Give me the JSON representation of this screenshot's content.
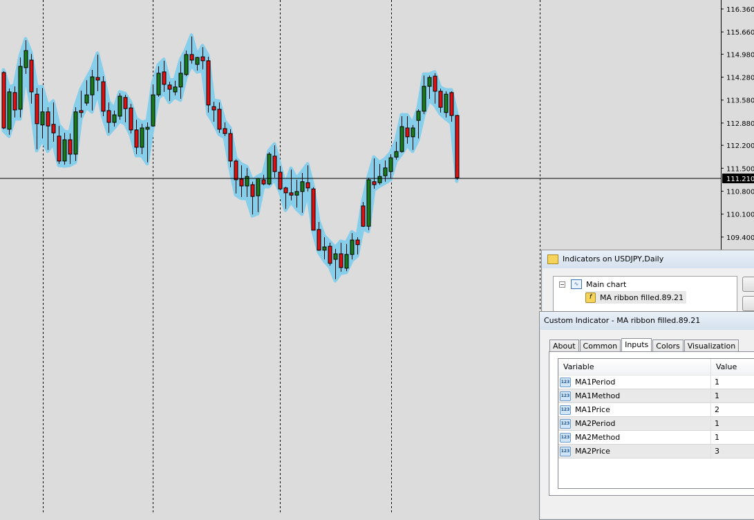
{
  "chart": {
    "symbol": "USDJPY",
    "timeframe": "Daily",
    "current_price_label": "111.210",
    "colors": {
      "background": "#dcdcdc",
      "bull": "#1a7a1a",
      "bear": "#e01010",
      "ribbon": "#87ceeb",
      "price_line": "#000000"
    },
    "chart_data": {
      "type": "candlestick",
      "y_ticks": [
        "116.360",
        "115.660",
        "114.980",
        "114.280",
        "113.580",
        "112.880",
        "112.200",
        "111.500",
        "110.800",
        "110.100",
        "109.400"
      ],
      "ylim": [
        108.0,
        116.6
      ],
      "grid": "vertical dashed",
      "ohlc": [
        [
          114.42,
          114.46,
          112.69,
          112.73
        ],
        [
          112.69,
          113.93,
          112.52,
          113.83
        ],
        [
          113.81,
          114.0,
          113.05,
          113.28
        ],
        [
          113.3,
          114.88,
          113.05,
          114.61
        ],
        [
          114.57,
          115.41,
          114.38,
          115.09
        ],
        [
          114.8,
          114.99,
          113.47,
          113.83
        ],
        [
          113.76,
          113.95,
          112.08,
          112.86
        ],
        [
          112.82,
          113.95,
          112.41,
          113.22
        ],
        [
          113.22,
          113.36,
          112.06,
          112.79
        ],
        [
          112.84,
          113.51,
          112.31,
          112.58
        ],
        [
          112.48,
          112.79,
          111.63,
          111.72
        ],
        [
          111.72,
          112.58,
          111.61,
          112.37
        ],
        [
          112.37,
          112.56,
          111.63,
          111.93
        ],
        [
          111.93,
          113.36,
          111.72,
          113.22
        ],
        [
          113.26,
          113.87,
          113.05,
          113.2
        ],
        [
          113.49,
          114.19,
          113.41,
          113.74
        ],
        [
          113.74,
          114.5,
          113.26,
          114.29
        ],
        [
          114.27,
          114.97,
          113.85,
          114.19
        ],
        [
          114.14,
          114.31,
          113.09,
          113.24
        ],
        [
          113.26,
          113.51,
          112.58,
          112.9
        ],
        [
          112.9,
          113.26,
          112.77,
          113.13
        ],
        [
          113.09,
          113.79,
          112.98,
          113.7
        ],
        [
          113.66,
          113.74,
          112.9,
          113.32
        ],
        [
          113.34,
          113.47,
          112.56,
          112.67
        ],
        [
          112.67,
          112.98,
          111.93,
          112.14
        ],
        [
          112.14,
          112.86,
          111.93,
          112.73
        ],
        [
          112.69,
          112.9,
          111.68,
          112.75
        ],
        [
          112.79,
          114.06,
          112.77,
          113.74
        ],
        [
          113.74,
          114.61,
          113.68,
          114.4
        ],
        [
          114.44,
          114.78,
          113.83,
          114.06
        ],
        [
          114.04,
          114.14,
          113.55,
          113.91
        ],
        [
          113.83,
          114.17,
          113.72,
          113.98
        ],
        [
          113.98,
          114.76,
          113.62,
          114.4
        ],
        [
          114.36,
          115.09,
          114.31,
          114.97
        ],
        [
          114.97,
          115.52,
          114.69,
          114.8
        ],
        [
          114.67,
          114.9,
          114.48,
          114.88
        ],
        [
          114.9,
          115.2,
          114.52,
          114.78
        ],
        [
          114.78,
          114.9,
          113.2,
          113.43
        ],
        [
          113.38,
          113.53,
          112.92,
          113.28
        ],
        [
          113.3,
          113.51,
          112.58,
          112.69
        ],
        [
          112.71,
          112.9,
          112.48,
          112.56
        ],
        [
          112.56,
          112.69,
          111.53,
          111.72
        ],
        [
          111.72,
          111.78,
          110.73,
          111.15
        ],
        [
          111.17,
          111.59,
          110.62,
          110.96
        ],
        [
          110.96,
          111.51,
          110.62,
          111.25
        ],
        [
          111.0,
          111.09,
          110.09,
          110.64
        ],
        [
          110.66,
          111.21,
          110.16,
          111.19
        ],
        [
          111.15,
          111.3,
          110.98,
          111.02
        ],
        [
          111.02,
          111.99,
          110.98,
          111.93
        ],
        [
          111.87,
          112.2,
          111.21,
          111.4
        ],
        [
          111.38,
          111.57,
          110.83,
          110.87
        ],
        [
          110.9,
          110.94,
          110.26,
          110.75
        ],
        [
          110.75,
          111.46,
          110.52,
          110.68
        ],
        [
          110.68,
          111.15,
          110.3,
          110.79
        ],
        [
          110.79,
          111.36,
          110.14,
          111.09
        ],
        [
          111.06,
          111.59,
          110.79,
          110.9
        ],
        [
          110.87,
          110.92,
          109.61,
          109.61
        ],
        [
          109.63,
          109.86,
          108.98,
          109.0
        ],
        [
          109.0,
          109.4,
          108.72,
          109.1
        ],
        [
          109.12,
          109.23,
          108.53,
          108.6
        ],
        [
          108.72,
          109.04,
          108.11,
          108.89
        ],
        [
          108.89,
          109.23,
          108.34,
          108.47
        ],
        [
          108.45,
          109.19,
          108.36,
          108.87
        ],
        [
          108.87,
          109.52,
          108.72,
          109.31
        ],
        [
          109.31,
          109.4,
          108.87,
          109.17
        ],
        [
          110.35,
          110.47,
          109.71,
          109.73
        ],
        [
          109.73,
          111.21,
          109.61,
          111.15
        ],
        [
          111.09,
          111.8,
          110.87,
          111.0
        ],
        [
          111.06,
          111.63,
          111.0,
          111.25
        ],
        [
          111.27,
          111.74,
          111.09,
          111.51
        ],
        [
          111.4,
          111.93,
          111.19,
          111.82
        ],
        [
          111.84,
          112.31,
          111.76,
          112.01
        ],
        [
          112.01,
          113.09,
          111.97,
          112.77
        ],
        [
          112.73,
          113.09,
          112.25,
          112.46
        ],
        [
          112.46,
          112.82,
          112.06,
          112.73
        ],
        [
          112.96,
          113.3,
          112.41,
          113.24
        ],
        [
          113.24,
          114.33,
          113.15,
          114.0
        ],
        [
          114.0,
          114.33,
          113.62,
          114.27
        ],
        [
          114.31,
          114.4,
          113.47,
          113.85
        ],
        [
          113.85,
          113.93,
          113.2,
          113.36
        ],
        [
          113.2,
          113.85,
          113.05,
          113.76
        ],
        [
          113.81,
          113.85,
          112.92,
          113.11
        ],
        [
          113.11,
          113.13,
          111.15,
          111.21
        ]
      ]
    }
  },
  "indicators_dialog": {
    "title": "Indicators on USDJPY,Daily",
    "tree": {
      "root": "Main chart",
      "child": "MA ribbon filled.89.21"
    }
  },
  "custom_indicator_dialog": {
    "title": "Custom Indicator - MA ribbon filled.89.21",
    "tabs": [
      {
        "label": "About"
      },
      {
        "label": "Common"
      },
      {
        "label": "Inputs"
      },
      {
        "label": "Colors"
      },
      {
        "label": "Visualization"
      }
    ],
    "active_tab": "Inputs",
    "columns": {
      "variable": "Variable",
      "value": "Value"
    },
    "rows": [
      {
        "variable": "MA1Period",
        "value": "1",
        "icon": "123"
      },
      {
        "variable": "MA1Method",
        "value": "1",
        "icon": "123"
      },
      {
        "variable": "MA1Price",
        "value": "2",
        "icon": "123"
      },
      {
        "variable": "MA2Period",
        "value": "1",
        "icon": "123"
      },
      {
        "variable": "MA2Method",
        "value": "1",
        "icon": "123"
      },
      {
        "variable": "MA2Price",
        "value": "3",
        "icon": "123"
      }
    ]
  }
}
